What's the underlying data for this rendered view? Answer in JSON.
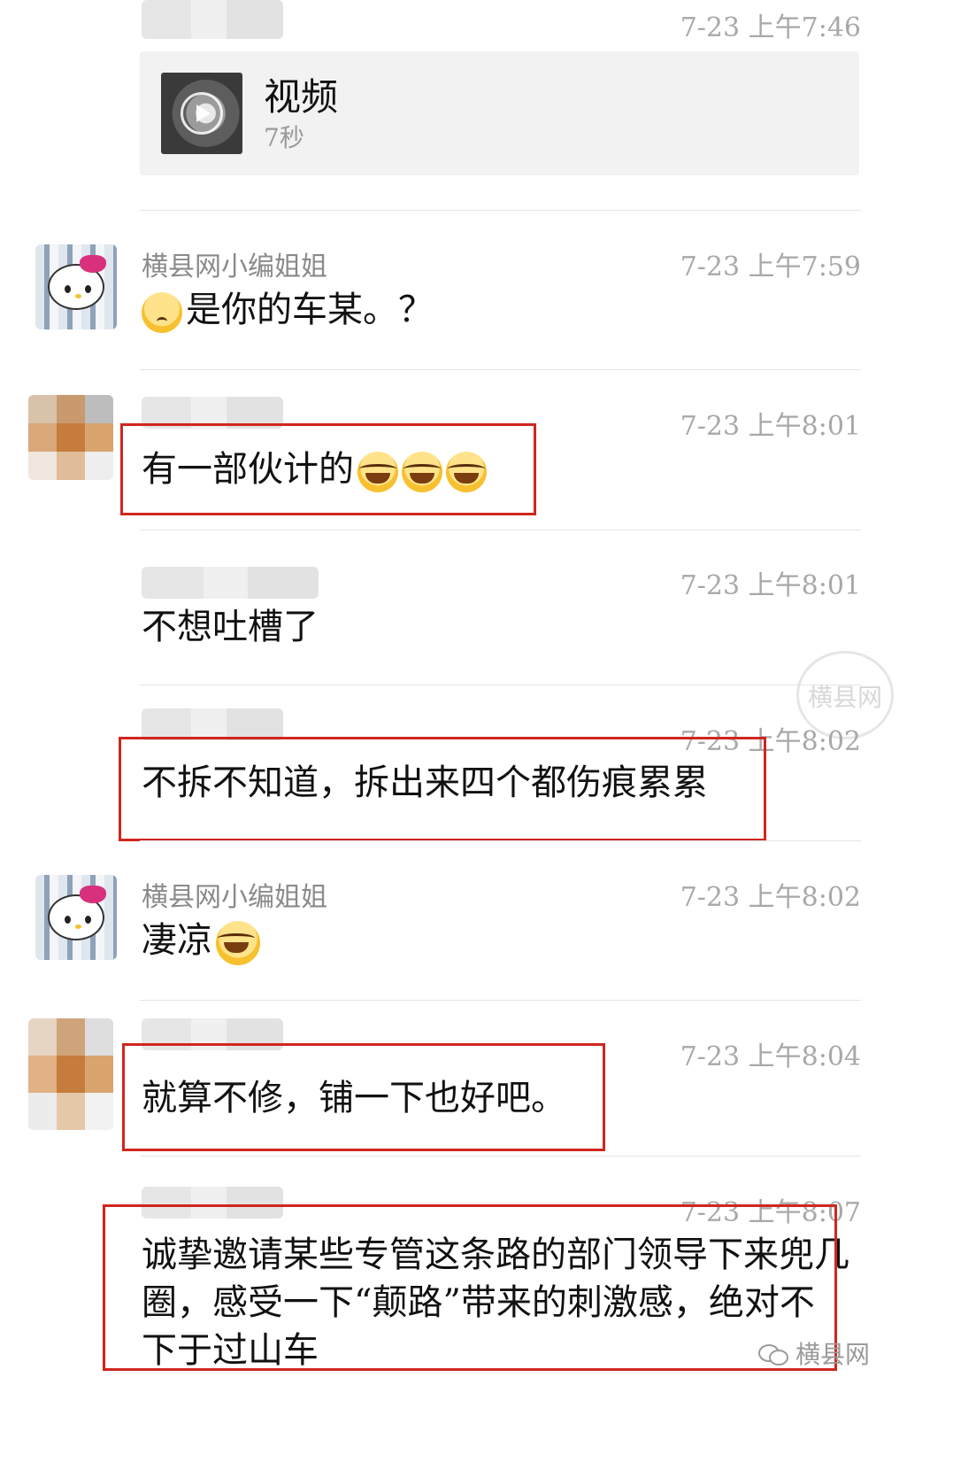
{
  "messages": [
    {
      "id": "m1",
      "time": "7-23 上午7:46",
      "video": {
        "title": "视频",
        "duration": "7秒"
      }
    },
    {
      "id": "m2",
      "sender": "横县网小编姐姐",
      "time": "7-23 上午7:59",
      "text": "是你的车某。？",
      "emoji_before": "worried-face-emoji"
    },
    {
      "id": "m3",
      "time": "7-23 上午8:01",
      "text": "有一部伙计的",
      "emoji_after": [
        "tears-of-joy-emoji",
        "tears-of-joy-emoji",
        "tears-of-joy-emoji"
      ]
    },
    {
      "id": "m4",
      "time": "7-23 上午8:01",
      "text": "不想吐槽了"
    },
    {
      "id": "m5",
      "time": "7-23 上午8:02",
      "text": "不拆不知道，拆出来四个都伤痕累累"
    },
    {
      "id": "m6",
      "sender": "横县网小编姐姐",
      "time": "7-23 上午8:02",
      "text": "凄凉",
      "emoji_after": [
        "face-palm-emoji"
      ]
    },
    {
      "id": "m7",
      "time": "7-23 上午8:04",
      "text": "就算不修，铺一下也好吧。"
    },
    {
      "id": "m8",
      "time": "7-23 上午8:07",
      "text": "诚挚邀请某些专管这条路的部门领导下来兜几圈，感受一下“颠路”带来的刺激感，绝对不下于过山车"
    }
  ],
  "watermark": {
    "text": "横县网",
    "stamp_text": "横县网"
  },
  "colors": {
    "highlight": "#d0261e",
    "timestamp": "#a8a8a8",
    "divider": "#e5e5e5"
  }
}
